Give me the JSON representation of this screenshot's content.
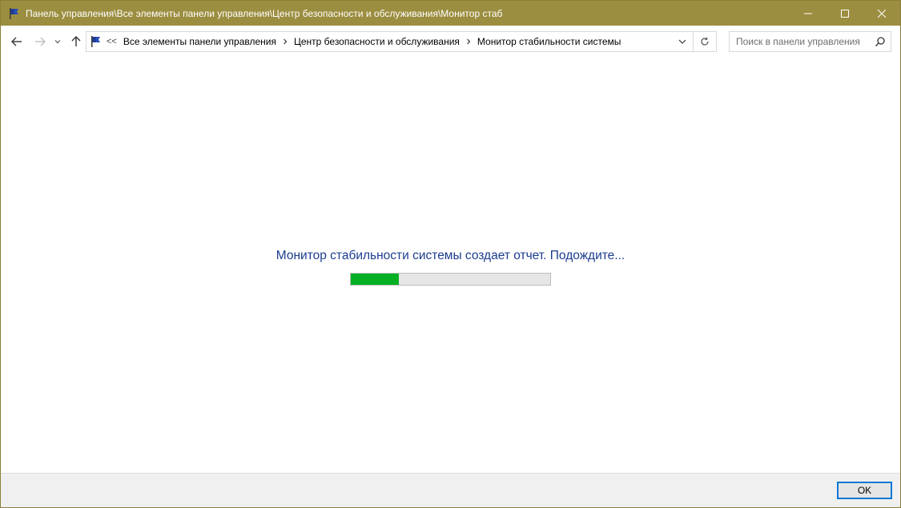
{
  "window": {
    "title": "Панель управления\\Все элементы панели управления\\Центр безопасности и обслуживания\\Монитор стаб",
    "icon": "flag-icon"
  },
  "nav": {
    "back_icon": "back-arrow-icon",
    "forward_icon": "forward-arrow-icon",
    "recent_icon": "chevron-down-icon",
    "up_icon": "up-arrow-icon",
    "address": {
      "overflow_label": "<<",
      "crumbs": [
        "Все элементы панели управления",
        "Центр безопасности и обслуживания",
        "Монитор стабильности системы"
      ]
    },
    "search": {
      "placeholder": "Поиск в панели управления",
      "value": ""
    }
  },
  "content": {
    "status_text": "Монитор стабильности системы создает отчет. Подождите...",
    "progress_fraction": 0.24
  },
  "footer": {
    "ok_label": "OK"
  },
  "colors": {
    "titlebar": "#9c8e40",
    "status_text": "#1c3c8f",
    "progress_fill": "#06b025",
    "ok_border": "#0078d7"
  }
}
